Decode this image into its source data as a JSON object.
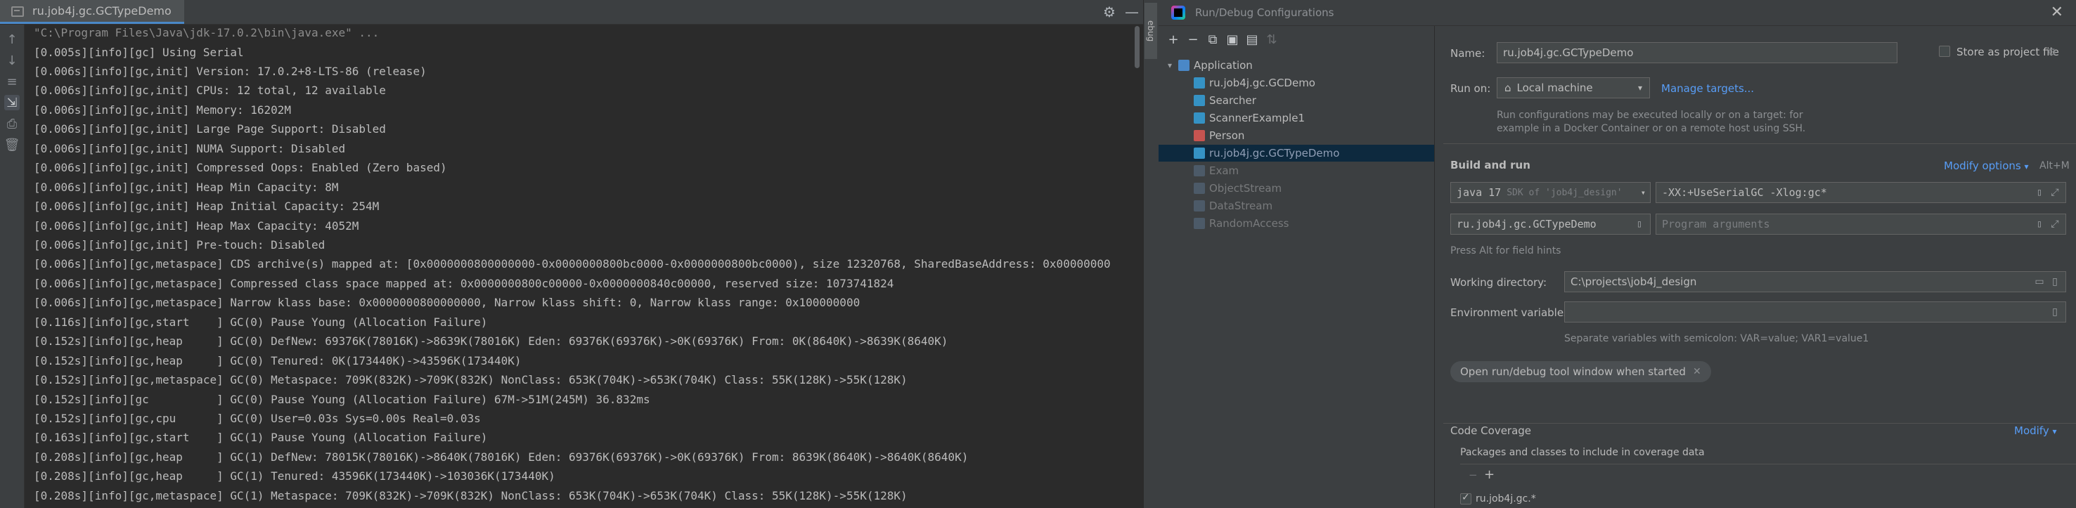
{
  "console": {
    "tab_label": "ru.job4j.gc.GCTypeDemo",
    "lines": [
      "\"C:\\Program Files\\Java\\jdk-17.0.2\\bin\\java.exe\" ...",
      "[0.005s][info][gc] Using Serial",
      "[0.006s][info][gc,init] Version: 17.0.2+8-LTS-86 (release)",
      "[0.006s][info][gc,init] CPUs: 12 total, 12 available",
      "[0.006s][info][gc,init] Memory: 16202M",
      "[0.006s][info][gc,init] Large Page Support: Disabled",
      "[0.006s][info][gc,init] NUMA Support: Disabled",
      "[0.006s][info][gc,init] Compressed Oops: Enabled (Zero based)",
      "[0.006s][info][gc,init] Heap Min Capacity: 8M",
      "[0.006s][info][gc,init] Heap Initial Capacity: 254M",
      "[0.006s][info][gc,init] Heap Max Capacity: 4052M",
      "[0.006s][info][gc,init] Pre-touch: Disabled",
      "[0.006s][info][gc,metaspace] CDS archive(s) mapped at: [0x0000000800000000-0x0000000800bc0000-0x0000000800bc0000), size 12320768, SharedBaseAddress: 0x00000000",
      "[0.006s][info][gc,metaspace] Compressed class space mapped at: 0x0000000800c00000-0x0000000840c00000, reserved size: 1073741824",
      "[0.006s][info][gc,metaspace] Narrow klass base: 0x0000000800000000, Narrow klass shift: 0, Narrow klass range: 0x100000000",
      "[0.116s][info][gc,start    ] GC(0) Pause Young (Allocation Failure)",
      "[0.152s][info][gc,heap     ] GC(0) DefNew: 69376K(78016K)->8639K(78016K) Eden: 69376K(69376K)->0K(69376K) From: 0K(8640K)->8639K(8640K)",
      "[0.152s][info][gc,heap     ] GC(0) Tenured: 0K(173440K)->43596K(173440K)",
      "[0.152s][info][gc,metaspace] GC(0) Metaspace: 709K(832K)->709K(832K) NonClass: 653K(704K)->653K(704K) Class: 55K(128K)->55K(128K)",
      "[0.152s][info][gc          ] GC(0) Pause Young (Allocation Failure) 67M->51M(245M) 36.832ms",
      "[0.152s][info][gc,cpu      ] GC(0) User=0.03s Sys=0.00s Real=0.03s",
      "[0.163s][info][gc,start    ] GC(1) Pause Young (Allocation Failure)",
      "[0.208s][info][gc,heap     ] GC(1) DefNew: 78015K(78016K)->8640K(78016K) Eden: 69376K(69376K)->0K(69376K) From: 8639K(8640K)->8640K(8640K)",
      "[0.208s][info][gc,heap     ] GC(1) Tenured: 43596K(173440K)->103036K(173440K)",
      "[0.208s][info][gc,metaspace] GC(1) Metaspace: 709K(832K)->709K(832K) NonClass: 653K(704K)->653K(704K) Class: 55K(128K)->55K(128K)"
    ],
    "side_tab": "ebug"
  },
  "dialog": {
    "title": "Run/Debug Configurations",
    "tree": {
      "group": "Application",
      "items": [
        {
          "label": "ru.job4j.gc.GCDemo",
          "state": "normal"
        },
        {
          "label": "Searcher",
          "state": "normal"
        },
        {
          "label": "ScannerExample1",
          "state": "normal"
        },
        {
          "label": "Person",
          "state": "normal"
        },
        {
          "label": "ru.job4j.gc.GCTypeDemo",
          "state": "selected"
        },
        {
          "label": "Exam",
          "state": "dim"
        },
        {
          "label": "ObjectStream",
          "state": "dim"
        },
        {
          "label": "DataStream",
          "state": "dim"
        },
        {
          "label": "RandomAccess",
          "state": "dim"
        }
      ]
    },
    "form": {
      "name_label": "Name:",
      "name_value": "ru.job4j.gc.GCTypeDemo",
      "store_label": "Store as project file",
      "run_on_label": "Run on:",
      "run_on_value": "Local machine",
      "manage_targets": "Manage targets...",
      "run_on_hint_1": "Run configurations may be executed locally or on a target: for",
      "run_on_hint_2": "example in a Docker Container or on a remote host using SSH.",
      "build_and_run": "Build and run",
      "modify_options": "Modify options",
      "modify_options_shortcut": "Alt+M",
      "jdk_value": "java 17",
      "jdk_hint": "SDK of 'job4j_design'",
      "vm_options": "-XX:+UseSerialGC -Xlog:gc*",
      "main_class": "ru.job4j.gc.GCTypeDemo",
      "program_args_placeholder": "Program arguments",
      "alt_hint": "Press Alt for field hints",
      "workdir_label": "Working directory:",
      "workdir_value": "C:\\projects\\job4j_design",
      "env_label": "Environment variables:",
      "env_hint": "Separate variables with semicolon: VAR=value; VAR1=value1",
      "open_tool_window": "Open run/debug tool window when started",
      "code_coverage": "Code Coverage",
      "modify": "Modify",
      "coverage_hint": "Packages and classes to include in coverage data",
      "coverage_entry": "ru.job4j.gc.*"
    }
  },
  "colors": {
    "background": "#2b2b2b",
    "panel": "#3c3f41",
    "selection": "#0d293e",
    "link": "#589df6",
    "accent": "#4a88c7"
  }
}
